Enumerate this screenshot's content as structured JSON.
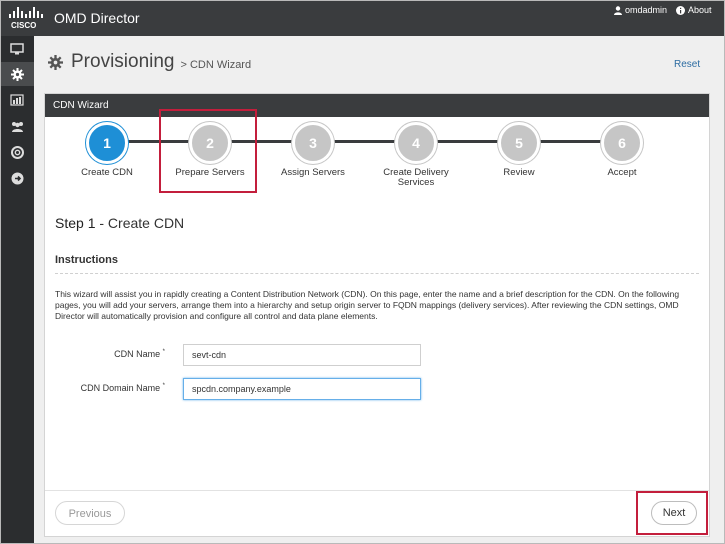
{
  "app": {
    "title": "OMD Director",
    "user": "omdadmin",
    "about": "About"
  },
  "header": {
    "title": "Provisioning",
    "breadcrumb": "> CDN Wizard",
    "reset": "Reset"
  },
  "panel": {
    "title": "CDN Wizard"
  },
  "steps": [
    {
      "num": "1",
      "label": "Create CDN",
      "active": true
    },
    {
      "num": "2",
      "label": "Prepare Servers",
      "active": false
    },
    {
      "num": "3",
      "label": "Assign Servers",
      "active": false
    },
    {
      "num": "4",
      "label": "Create Delivery Services",
      "active": false
    },
    {
      "num": "5",
      "label": "Review",
      "active": false
    },
    {
      "num": "6",
      "label": "Accept",
      "active": false
    }
  ],
  "step_heading": {
    "num": "Step 1",
    "name": "- Create CDN"
  },
  "instructions": {
    "title": "Instructions",
    "text": "This wizard will assist you in rapidly creating a Content Distribution Network (CDN). On this page, enter the name and a brief description for the CDN. On the following pages, you will add your servers, arrange them into a hierarchy and setup origin server to FQDN mappings (delivery services). After reviewing the CDN settings, OMD Director will automatically provision and configure all control and data plane elements."
  },
  "form": {
    "cdn_name": {
      "label": "CDN Name",
      "required": "*",
      "value": "sevt-cdn"
    },
    "cdn_domain": {
      "label": "CDN Domain Name",
      "required": "*",
      "value": "spcdn.company.example"
    }
  },
  "footer": {
    "previous": "Previous",
    "next": "Next"
  },
  "colors": {
    "active_step": "#1e8fd6",
    "highlight": "#c31e3c",
    "topbar": "#3a3c3e"
  }
}
